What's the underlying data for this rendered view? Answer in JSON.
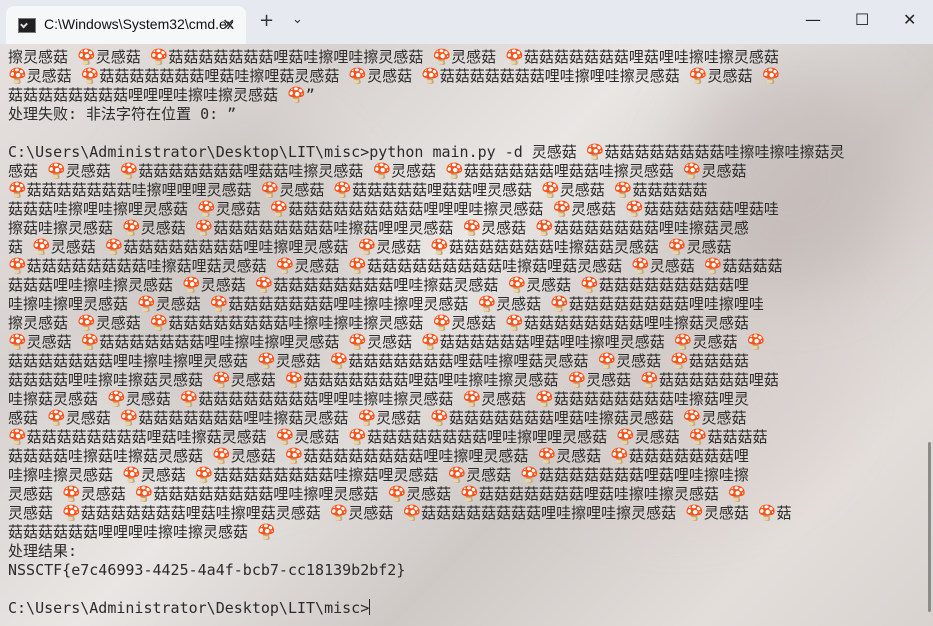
{
  "window": {
    "tab_title": "C:\\Windows\\System32\\cmd.ex",
    "tab_close": "✕",
    "new_tab": "+",
    "dropdown": "⌄",
    "minimize": "—",
    "maximize": "☐",
    "close": "✕"
  },
  "terminal": {
    "lines": [
      "擦灵感菇 🍄灵感菇 🍄菇菇菇菇菇菇菇哩菇哇擦哩哇擦灵感菇 🍄灵感菇 🍄菇菇菇菇菇菇菇哩菇哩哇擦哇擦灵感菇",
      "🍄灵感菇 🍄菇菇菇菇菇菇菇哩菇哇擦哩菇灵感菇 🍄灵感菇 🍄菇菇菇菇菇菇菇哩哇擦哩哇擦灵感菇 🍄灵感菇 🍄",
      "菇菇菇菇菇菇菇菇哩哩哩哇擦哇擦灵感菇 🍄”",
      "处理失败: 非法字符在位置 0: ”",
      "",
      "C:\\Users\\Administrator\\Desktop\\LIT\\misc>python main.py -d 灵感菇 🍄菇菇菇菇菇菇菇菇哇擦哇擦哇擦菇灵",
      "感菇 🍄灵感菇 🍄菇菇菇菇菇菇菇哩菇菇哇擦灵感菇 🍄灵感菇 🍄菇菇菇菇菇菇哩菇菇哇擦灵感菇 🍄灵感菇",
      "🍄菇菇菇菇菇菇菇哇擦哩哩哩灵感菇 🍄灵感菇 🍄菇菇菇菇菇哩菇菇哩灵感菇 🍄灵感菇 🍄菇菇菇菇菇",
      "菇菇菇哇擦哩哇擦哩灵感菇 🍄灵感菇 🍄菇菇菇菇菇菇菇菇菇哩哩哩哇擦灵感菇 🍄灵感菇 🍄菇菇菇菇菇菇哩菇哇",
      "擦菇哇擦灵感菇 🍄灵感菇 🍄菇菇菇菇菇菇菇菇哇擦菇哩哩灵感菇 🍄灵感菇 🍄菇菇菇菇菇菇菇哩哇擦菇灵感",
      "菇 🍄灵感菇 🍄菇菇菇菇菇菇菇菇哩哇擦哩灵感菇 🍄灵感菇 🍄菇菇菇菇菇菇菇哇擦菇菇灵感菇 🍄灵感菇",
      "🍄菇菇菇菇菇菇菇菇哇擦菇哩菇灵感菇 🍄灵感菇 🍄菇菇菇菇菇菇菇菇菇哇擦菇哩菇灵感菇 🍄灵感菇 🍄菇菇菇菇",
      "菇菇菇哩哇擦哇擦灵感菇 🍄灵感菇 🍄菇菇菇菇菇菇菇菇哩哇擦菇灵感菇 🍄灵感菇 🍄菇菇菇菇菇菇菇菇菇哩",
      "哇擦哇擦哩灵感菇 🍄灵感菇 🍄菇菇菇菇菇菇菇哩哇擦哇擦哩灵感菇 🍄灵感菇 🍄菇菇菇菇菇菇菇菇哩哇擦哩哇",
      "擦灵感菇 🍄灵感菇 🍄菇菇菇菇菇菇菇菇哇擦哇擦哇擦灵感菇 🍄灵感菇 🍄菇菇菇菇菇菇菇菇哩哇擦菇灵感菇",
      "🍄灵感菇 🍄菇菇菇菇菇菇菇哩哇擦哇擦哩灵感菇 🍄灵感菇 🍄菇菇菇菇菇菇哩菇哩哇擦哩灵感菇 🍄灵感菇 🍄",
      "菇菇菇菇菇菇菇哩哇擦哇擦哩灵感菇 🍄灵感菇 🍄菇菇菇菇菇菇菇哩菇哇擦哩菇灵感菇 🍄灵感菇 🍄菇菇菇菇",
      "菇菇菇菇哩哇擦哇擦菇灵感菇 🍄灵感菇 🍄菇菇菇菇菇菇菇哩菇哩哇擦哇擦灵感菇 🍄灵感菇 🍄菇菇菇菇菇菇哩菇",
      "哇擦菇灵感菇 🍄灵感菇 🍄菇菇菇菇菇菇菇菇哩哩哇擦哇擦灵感菇 🍄灵感菇 🍄菇菇菇菇菇菇菇菇哇擦菇哩灵",
      "感菇 🍄灵感菇 🍄菇菇菇菇菇菇菇哩哇擦菇灵感菇 🍄灵感菇 🍄菇菇菇菇菇菇菇哩菇哇擦菇灵感菇 🍄灵感菇",
      "🍄菇菇菇菇菇菇菇菇哩菇哇擦菇灵感菇 🍄灵感菇 🍄菇菇菇菇菇菇菇菇哩哇擦哩哩灵感菇 🍄灵感菇 🍄菇菇菇菇",
      "菇菇菇菇哇擦菇哇擦菇灵感菇 🍄灵感菇 🍄菇菇菇菇菇菇菇菇哩哇擦哩灵感菇 🍄灵感菇 🍄菇菇菇菇菇菇菇哩",
      "哇擦哇擦灵感菇 🍄灵感菇 🍄菇菇菇菇菇菇菇菇哇擦菇哩灵感菇 🍄灵感菇 🍄菇菇菇菇菇菇菇哩菇哩哇擦哇擦",
      "灵感菇 🍄灵感菇 🍄菇菇菇菇菇菇菇菇哩哇擦哩灵感菇 🍄灵感菇 🍄菇菇菇菇菇菇菇哩菇哇擦哇擦灵感菇 🍄",
      "灵感菇 🍄菇菇菇菇菇菇菇哩菇哇擦哩菇灵感菇 🍄灵感菇 🍄菇菇菇菇菇菇菇菇哩哇擦哩哇擦灵感菇 🍄灵感菇 🍄菇",
      "菇菇菇菇菇菇哩哩哩哇擦哇擦灵感菇 🍄",
      "处理结果:",
      "NSSCTF{e7c46993-4425-4a4f-bcb7-cc18139b2bf2}",
      "",
      "C:\\Users\\Administrator\\Desktop\\LIT\\misc>"
    ]
  }
}
